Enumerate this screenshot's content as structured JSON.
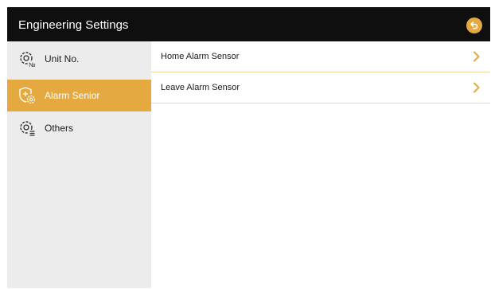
{
  "header": {
    "title": "Engineering Settings"
  },
  "sidebar": {
    "items": [
      {
        "label": "Unit No.",
        "icon": "gear-number-icon",
        "active": false
      },
      {
        "label": "Alarm Senior",
        "icon": "shield-gear-icon",
        "active": true
      },
      {
        "label": "Others",
        "icon": "gear-list-icon",
        "active": false
      }
    ]
  },
  "content": {
    "rows": [
      {
        "label": "Home Alarm Sensor",
        "icon": "chevron-right-icon"
      },
      {
        "label": "Leave Alarm Sensor",
        "icon": "chevron-right-icon"
      }
    ]
  },
  "colors": {
    "accent": "#e4a93f",
    "header_bg": "#0f0f0f",
    "sidebar_bg": "#ececec",
    "divider": "#f0d7a3"
  }
}
